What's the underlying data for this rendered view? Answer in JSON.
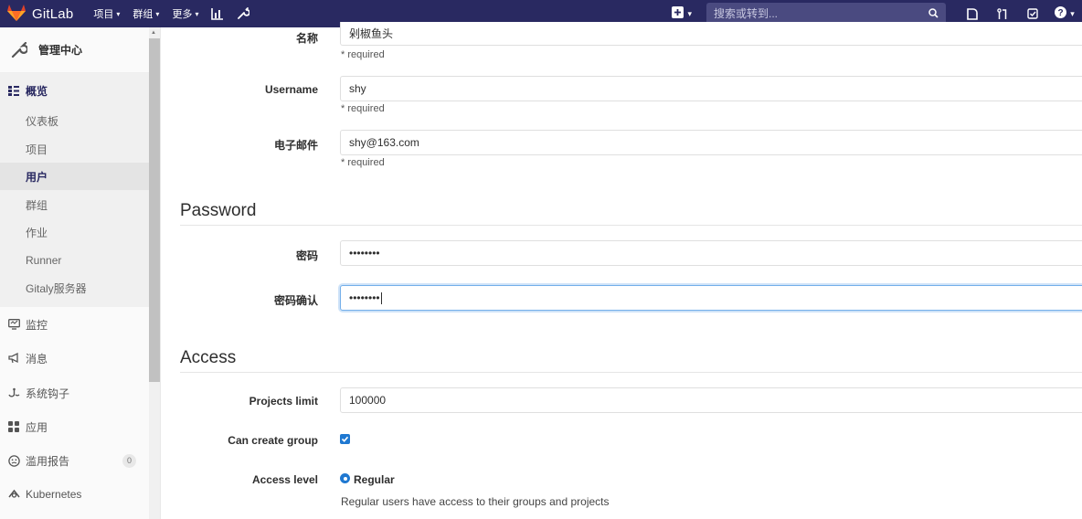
{
  "navbar": {
    "brand": "GitLab",
    "menu": [
      {
        "label": "项目",
        "caret": "⌄"
      },
      {
        "label": "群组",
        "caret": "⌄"
      },
      {
        "label": "更多",
        "caret": "⌄"
      }
    ],
    "search_placeholder": "搜索或转到...",
    "color": "#292961"
  },
  "sidebar": {
    "title": "管理中心",
    "overview": {
      "label": "概览"
    },
    "sub_items": [
      {
        "label": "仪表板"
      },
      {
        "label": "项目"
      },
      {
        "label": "用户"
      },
      {
        "label": "群组"
      },
      {
        "label": "作业"
      },
      {
        "label": "Runner"
      },
      {
        "label": "Gitaly服务器"
      }
    ],
    "items": [
      {
        "label": "监控",
        "icon": "monitor-icon"
      },
      {
        "label": "消息",
        "icon": "bullhorn-icon"
      },
      {
        "label": "系统钩子",
        "icon": "hook-icon"
      },
      {
        "label": "应用",
        "icon": "apps-icon"
      },
      {
        "label": "滥用报告",
        "icon": "abuse-icon",
        "badge": "0"
      },
      {
        "label": "Kubernetes",
        "icon": "kubernetes-icon"
      }
    ]
  },
  "form": {
    "name": {
      "label": "名称",
      "value": "剁椒鱼头",
      "help": "* required"
    },
    "username": {
      "label": "Username",
      "value": "shy",
      "help": "* required"
    },
    "email": {
      "label": "电子邮件",
      "value": "shy@163.com",
      "help": "* required"
    },
    "password_section": "Password",
    "password": {
      "label": "密码",
      "value": "••••••••"
    },
    "password_confirm": {
      "label": "密码确认",
      "value": "••••••••"
    },
    "access_section": "Access",
    "projects_limit": {
      "label": "Projects limit",
      "value": "100000"
    },
    "can_create_group": {
      "label": "Can create group",
      "checked": true
    },
    "access_level": {
      "label": "Access level",
      "option": "Regular",
      "help": "Regular users have access to their groups and projects"
    }
  }
}
